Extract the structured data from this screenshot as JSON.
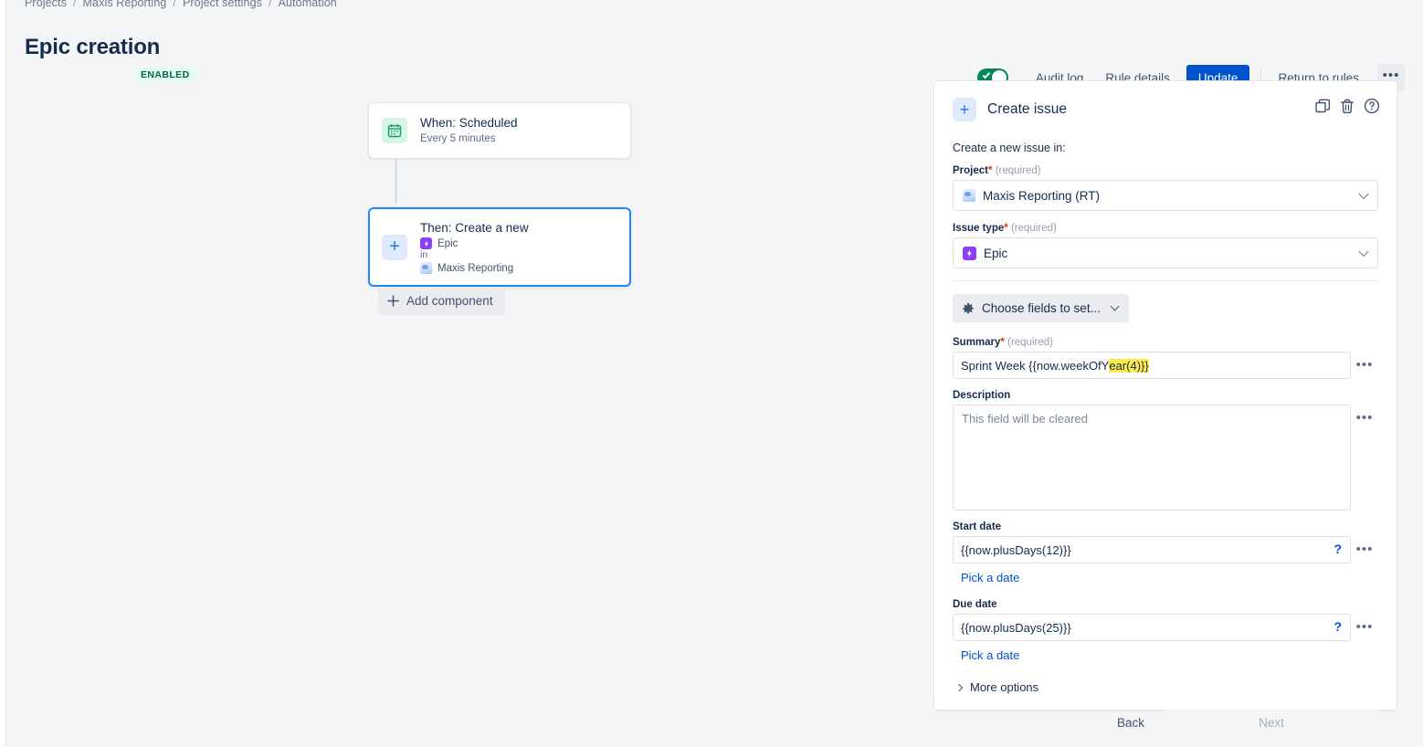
{
  "breadcrumb": {
    "items": [
      "Projects",
      "Maxis Reporting",
      "Project settings",
      "Automation"
    ],
    "separator": "/"
  },
  "header": {
    "title": "Epic creation",
    "status_badge": "ENABLED",
    "toggle_state": "on",
    "toggle_color": "#00875a",
    "actions": {
      "audit_log": "Audit log",
      "rule_details": "Rule details",
      "update": "Update",
      "return_to_rules": "Return to rules",
      "more": "•••"
    },
    "primary_color": "#0052cc"
  },
  "canvas": {
    "trigger": {
      "title": "When: Scheduled",
      "subtitle": "Every 5 minutes",
      "icon": "calendar-icon"
    },
    "action": {
      "title": "Then: Create a new",
      "issue_type": "Epic",
      "in_word": "in",
      "project": "Maxis Reporting",
      "icon": "plus-icon"
    },
    "add_component": "Add component"
  },
  "panel": {
    "title": "Create issue",
    "icons": {
      "duplicate": "duplicate-icon",
      "delete": "trash-icon",
      "help": "help-icon"
    },
    "intro": "Create a new issue in:",
    "project": {
      "label": "Project",
      "required_mark": "*",
      "required_text": "(required)",
      "value": "Maxis Reporting (RT)"
    },
    "issue_type": {
      "label": "Issue type",
      "required_mark": "*",
      "required_text": "(required)",
      "value": "Epic"
    },
    "choose_fields": "Choose fields to set...",
    "summary": {
      "label": "Summary",
      "required_mark": "*",
      "required_text": "(required)",
      "value_plain": "Sprint Week  {{now.weekOfY",
      "value_highlighted": "ear(4)}}"
    },
    "description": {
      "label": "Description",
      "placeholder": "This field will be cleared"
    },
    "start_date": {
      "label": "Start date",
      "value": "{{now.plusDays(12)}}",
      "help_glyph": "?",
      "pick_link": "Pick a date"
    },
    "due_date": {
      "label": "Due date",
      "value": "{{now.plusDays(25)}}",
      "help_glyph": "?",
      "pick_link": "Pick a date"
    },
    "more_options": "More options",
    "back": "Back",
    "next": "Next",
    "dots": "•••"
  }
}
